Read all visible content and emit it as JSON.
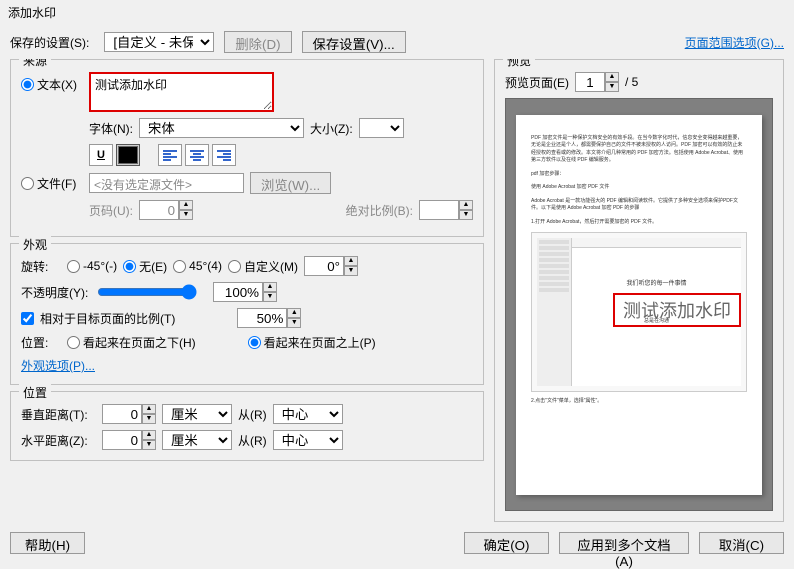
{
  "title": "添加水印",
  "savedSettings": {
    "label": "保存的设置(S):",
    "value": "[自定义 - 未保存]",
    "deleteBtn": "删除(D)",
    "saveBtn": "保存设置(V)..."
  },
  "pageRangeLink": "页面范围选项(G)...",
  "source": {
    "title": "来源",
    "textRadio": "文本(X)",
    "textValue": "测试添加水印",
    "fontLabel": "字体(N):",
    "fontValue": "宋体",
    "sizeLabel": "大小(Z):",
    "sizeValue": "",
    "fileRadio": "文件(F)",
    "filePath": "<没有选定源文件>",
    "browseBtn": "浏览(W)...",
    "pageLabel": "页码(U):",
    "pageValue": "0",
    "scaleLabel": "绝对比例(B):",
    "scaleValue": ""
  },
  "appearance": {
    "title": "外观",
    "rotateLabel": "旋转:",
    "rotNeg45": "-45°(-)",
    "rotNone": "无(E)",
    "rot45": "45°(4)",
    "rotCustom": "自定义(M)",
    "rotCustomValue": "0°",
    "opacityLabel": "不透明度(Y):",
    "opacityValue": "100%",
    "relativeScaleCheck": "相对于目标页面的比例(T)",
    "relativeScaleValue": "50%",
    "positionLabel": "位置:",
    "behindRadio": "看起来在页面之下(H)",
    "frontRadio": "看起来在页面之上(P)",
    "appearanceOptionsLink": "外观选项(P)..."
  },
  "position": {
    "title": "位置",
    "vDistLabel": "垂直距离(T):",
    "vDistValue": "0",
    "hDistLabel": "水平距离(Z):",
    "hDistValue": "0",
    "unit": "厘米",
    "fromLabel": "从(R)",
    "fromValue": "中心"
  },
  "preview": {
    "title": "预览",
    "pageLabel": "预览页面(E)",
    "pageValue": "1",
    "totalPages": "/ 5",
    "watermarkText": "测试添加水印",
    "bodyText1": "PDF 加密文件是一种保护文档安全的有效手段。在当今数字化时代，信息安全变得越来越重要，无论是企业还是个人，都需要保护自己的文件不被未授权的人访问。PDF 加密可以有效的防止未经授权的查看或的修改。本文将介绍几种常用的 PDF 加密方法。包括使用 Adobe Acrobat、使用第三方软件以及在线 PDF 编辑服务。",
    "bodyText2": "pdf 加密步骤：",
    "bodyText3": "使用 Adobe Acrobat 加密 PDF 文件",
    "bodyText4": "Adobe Acrobat 是一款功能强大的 PDF 编辑和阅读软件。它提供了多种安全选项来保护PDF文件。以下是使用 Adobe Acrobat 加密 PDF 的步骤",
    "bodyText5": "1.打开 Adobe Acrobat，然后打开需要加密的 PDF 文件。",
    "bodyText6": "2.点击\"文件\"菜单，选择\"属性\"。",
    "subCaption": "我们听您的每一件事情",
    "subCaption2": "总是在沟通"
  },
  "buttons": {
    "help": "帮助(H)",
    "ok": "确定(O)",
    "applyMultiple": "应用到多个文档(A)",
    "cancel": "取消(C)"
  }
}
